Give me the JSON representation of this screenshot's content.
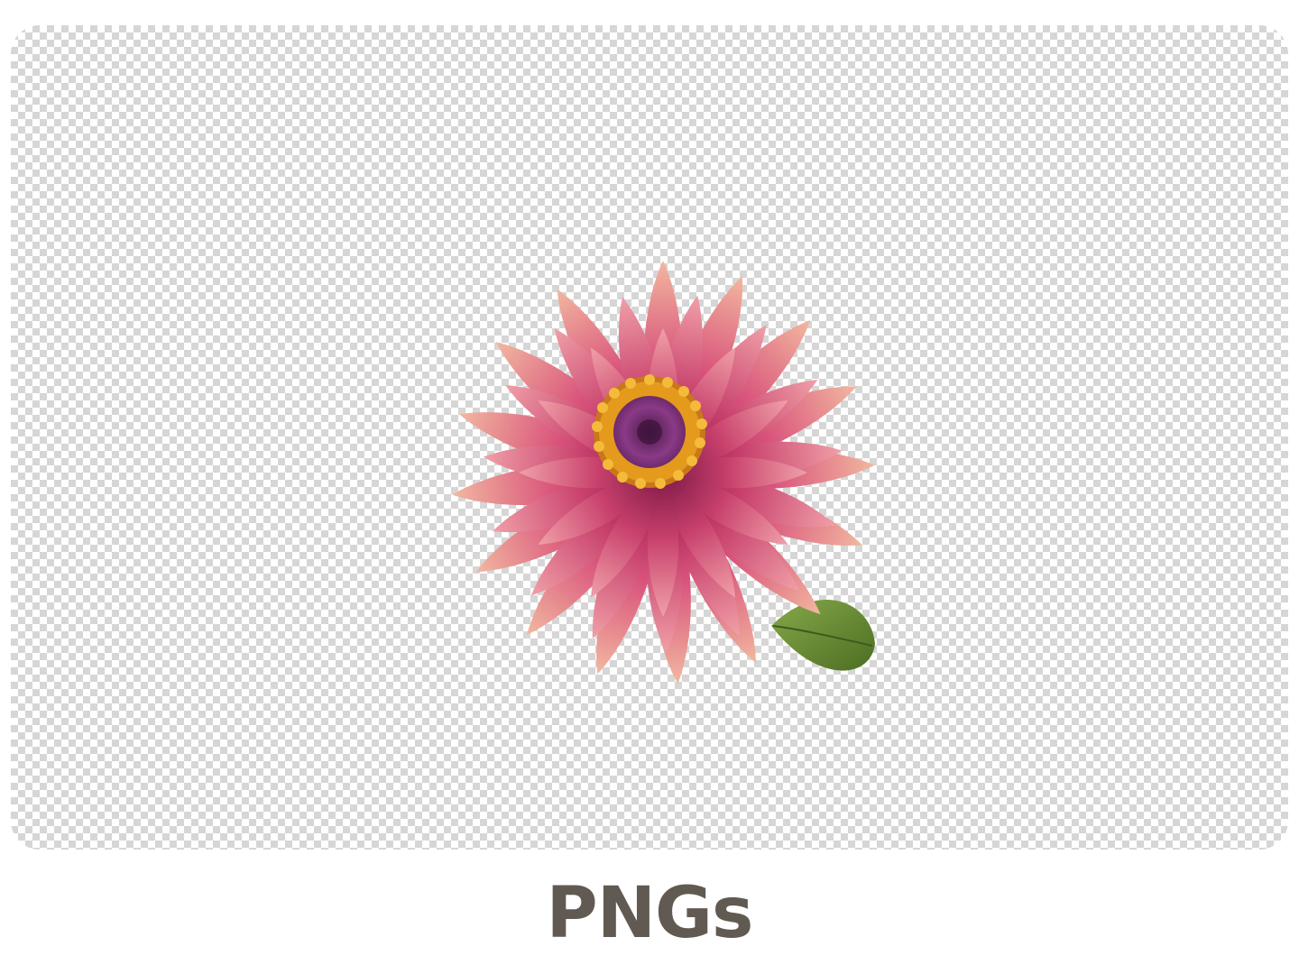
{
  "caption": {
    "text": "PNGs",
    "color": "#615a52"
  },
  "image": {
    "icon": "flower-icon",
    "petal_color": "#d8507a",
    "petal_tip_color": "#f2b8a0",
    "pollen_color": "#e49a1c",
    "center_color": "#6e2a6c",
    "leaf_color": "#5e8a2e"
  },
  "canvas": {
    "background": "transparent-checkerboard"
  }
}
